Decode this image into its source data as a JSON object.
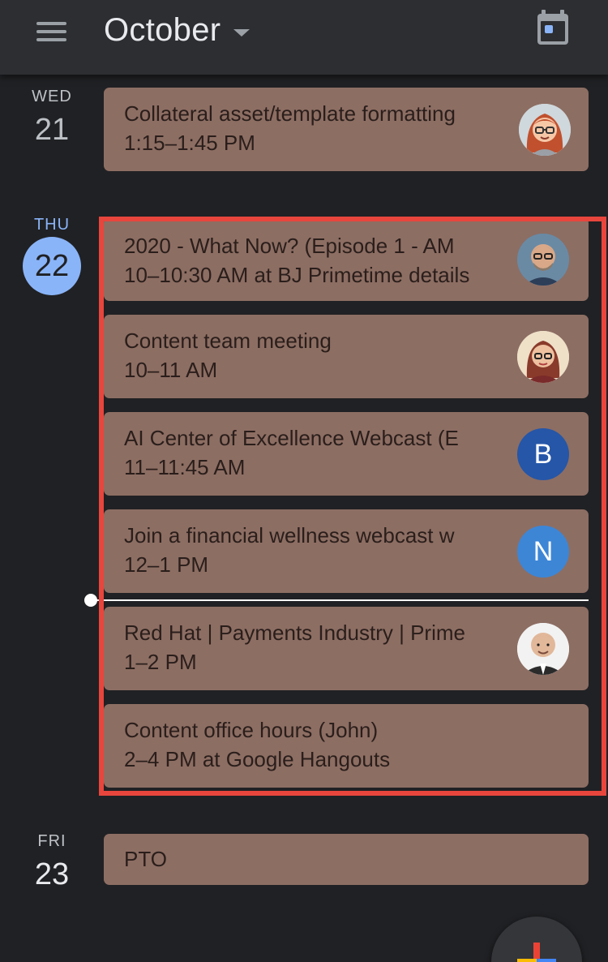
{
  "header": {
    "month": "October",
    "menu_icon": "hamburger-menu-icon",
    "today_icon": "calendar-today-icon"
  },
  "days": [
    {
      "dow": "WED",
      "date": "21",
      "events": [
        {
          "title": "Collateral asset/template formatting",
          "sub": "1:15–1:45 PM",
          "avatar": "cartoon-avatar-red-hair"
        }
      ]
    },
    {
      "dow": "THU",
      "date": "22",
      "today": true,
      "events": [
        {
          "title": "2020 - What Now?   (Episode 1 - AM",
          "sub": "10–10:30 AM at BJ Primetime details",
          "avatar": "photo-avatar-man-glasses"
        },
        {
          "title": "Content team meeting",
          "sub": "10–11 AM",
          "avatar": "photo-avatar-woman-glasses"
        },
        {
          "title": "AI Center of Excellence Webcast (E",
          "sub": "11–11:45 AM",
          "avatar_letter": "B",
          "avatar_color": "#2556a8"
        },
        {
          "title": "Join a financial wellness webcast w",
          "sub": "12–1 PM",
          "avatar_letter": "N",
          "avatar_color": "#3d86d6"
        },
        {
          "title": "Red Hat | Payments Industry | Prime",
          "sub": "1–2 PM",
          "avatar": "photo-avatar-bald-man"
        },
        {
          "title": "Content office hours (John)",
          "sub": "2–4 PM at Google Hangouts"
        }
      ]
    },
    {
      "dow": "FRI",
      "date": "23",
      "events": [
        {
          "title": "PTO"
        }
      ]
    }
  ],
  "colors": {
    "background": "#202124",
    "topbar": "#2d2e31",
    "event": "#8d6e63",
    "today_accent": "#8ab4f8",
    "highlight": "#e8453c"
  },
  "fab_icon": "plus-create-icon"
}
